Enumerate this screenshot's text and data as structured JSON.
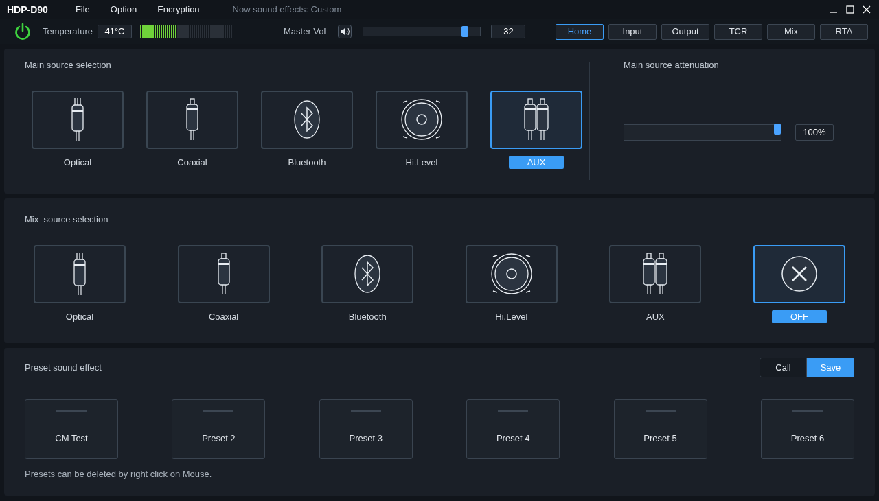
{
  "window": {
    "title": "HDP-D90",
    "menu": [
      "File",
      "Option",
      "Encryption"
    ],
    "status": "Now sound effects: Custom"
  },
  "toolbar": {
    "power_on": true,
    "temperature_label": "Temperature",
    "temperature": "41°C",
    "temperature_meter": {
      "level": 0.4
    },
    "master_vol_label": "Master Vol",
    "master_vol": {
      "level": 0.89,
      "reading": "32"
    },
    "tabs": [
      {
        "label": "Home",
        "selected": true
      },
      {
        "label": "Input",
        "selected": false
      },
      {
        "label": "Output",
        "selected": false
      },
      {
        "label": "TCR",
        "selected": false
      },
      {
        "label": "Mix",
        "selected": false
      },
      {
        "label": "RTA",
        "selected": false
      }
    ]
  },
  "main_source": {
    "title": "Main source selection",
    "sources": [
      {
        "kind": "optical",
        "label": "Optical",
        "selected": false
      },
      {
        "kind": "coaxial",
        "label": "Coaxial",
        "selected": false
      },
      {
        "kind": "bluetooth",
        "label": "Bluetooth",
        "selected": false
      },
      {
        "kind": "speaker",
        "label": "Hi.Level",
        "selected": false
      },
      {
        "kind": "rca",
        "label": "AUX",
        "selected": true
      }
    ]
  },
  "attenuation": {
    "title": "Main source attenuation",
    "level": 1,
    "reading": "100%"
  },
  "mix_source": {
    "title": "Mix  source selection",
    "sources": [
      {
        "kind": "optical",
        "label": "Optical",
        "selected": false
      },
      {
        "kind": "coaxial",
        "label": "Coaxial",
        "selected": false
      },
      {
        "kind": "bluetooth",
        "label": "Bluetooth",
        "selected": false
      },
      {
        "kind": "speaker",
        "label": "Hi.Level",
        "selected": false
      },
      {
        "kind": "rca",
        "label": "AUX",
        "selected": false
      },
      {
        "kind": "off",
        "label": "OFF",
        "selected": true
      }
    ]
  },
  "presets": {
    "title": "Preset sound effect",
    "actions": [
      {
        "label": "Call",
        "selected": false
      },
      {
        "label": "Save",
        "selected": true
      }
    ],
    "items": [
      "CM Test",
      "Preset 2",
      "Preset 3",
      "Preset 4",
      "Preset 5",
      "Preset 6"
    ],
    "note": "Presets can be deleted by right click on Mouse."
  }
}
